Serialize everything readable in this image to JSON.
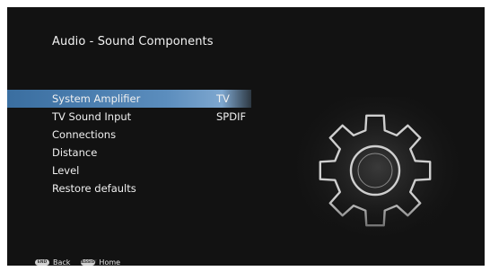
{
  "screen": {
    "title": "Audio - Sound Components"
  },
  "menu": {
    "items": [
      {
        "label": "System Amplifier",
        "value": "TV"
      },
      {
        "label": "TV Sound Input",
        "value": "SPDIF"
      },
      {
        "label": "Connections",
        "value": ""
      },
      {
        "label": "Distance",
        "value": ""
      },
      {
        "label": "Level",
        "value": ""
      },
      {
        "label": "Restore defaults",
        "value": ""
      }
    ],
    "selected_index": 0
  },
  "footer": {
    "back_key": "END",
    "back_label": "Back",
    "home_key": "ASSIST",
    "home_label": "Home"
  },
  "icons": {
    "settings_graphic": "gear-icon"
  },
  "colors": {
    "background": "#121212",
    "highlight": "#5b8dbd",
    "text": "#f0f0f0"
  }
}
